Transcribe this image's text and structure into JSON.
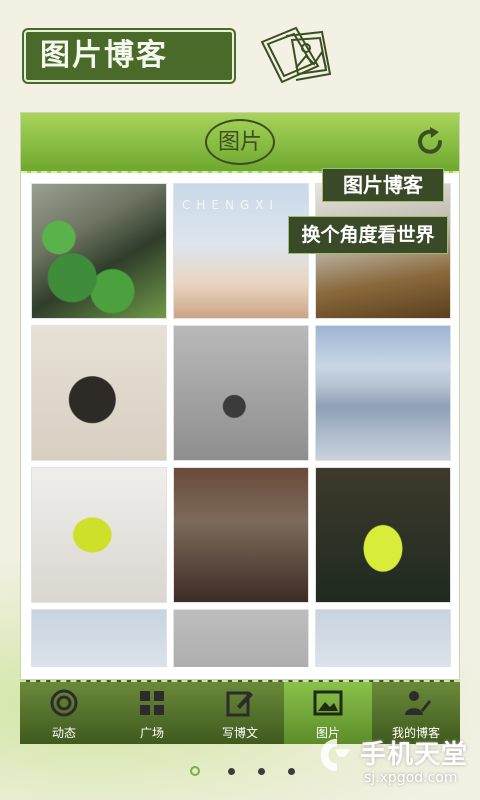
{
  "app": {
    "title": "图片博客"
  },
  "panel": {
    "title": "图片"
  },
  "overlay": {
    "line1": "图片博客",
    "line2": "换个角度看世界"
  },
  "tiles": [
    {
      "label": ""
    },
    {
      "label": "CHENGXI"
    },
    {
      "label": ""
    },
    {
      "label": ""
    },
    {
      "label": ""
    },
    {
      "label": ""
    },
    {
      "label": ""
    },
    {
      "label": ""
    },
    {
      "label": ""
    },
    {
      "label": ""
    },
    {
      "label": ""
    },
    {
      "label": ""
    }
  ],
  "nav": {
    "items": [
      {
        "label": "动态",
        "icon": "target-icon"
      },
      {
        "label": "广场",
        "icon": "grid-icon"
      },
      {
        "label": "写博文",
        "icon": "edit-icon"
      },
      {
        "label": "图片",
        "icon": "image-icon"
      },
      {
        "label": "我的博客",
        "icon": "person-icon"
      }
    ],
    "active_index": 3
  },
  "pager": {
    "active_index": 0,
    "count": 4
  },
  "watermark": {
    "text": "手机天堂",
    "url": "sj.xpgod.com"
  },
  "colors": {
    "accent": "#7ab33a",
    "dark_green": "#3f5a1e",
    "background": "#f3f0e4"
  }
}
